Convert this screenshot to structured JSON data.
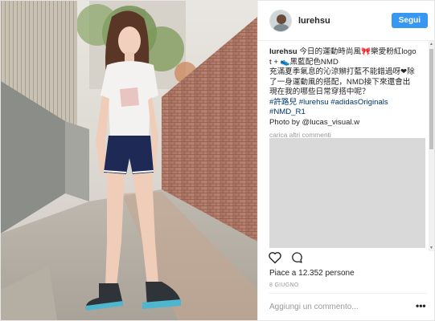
{
  "header": {
    "username": "lurehsu",
    "follow_label": "Segui"
  },
  "caption": {
    "username": "lurehsu",
    "line1": "今日的運動時尚風🎀樂愛粉紅logo",
    "line2": "t + 👟黑藍配色NMD",
    "line3": "充滿夏季氣息的沁涼辮打藍不能錯過呀❤除",
    "line4": "了一身運動風的搭配，NMD接下來還會出",
    "line5": "現在我的哪些日常穿搭中呢？",
    "hashtags": "#許路兒 #lurehsu #adidasOriginals",
    "hashtag2": "#NMD_R1",
    "credit": "Photo by @lucas_visual.w"
  },
  "comments": {
    "load_more": "carica altri commenti"
  },
  "engagement": {
    "likes_text": "Piace a 12.352 persone",
    "date": "8 GIUGNO"
  },
  "comment_box": {
    "placeholder": "Aggiungi un commento...",
    "more_label": "•••"
  },
  "icons": {
    "like": "heart-icon",
    "comment": "comment-bubble-icon",
    "more": "more-options-icon"
  },
  "colors": {
    "follow_button": "#3897f0",
    "hashtag": "#003569",
    "comments_placeholder_block": "#d9d9d9"
  }
}
